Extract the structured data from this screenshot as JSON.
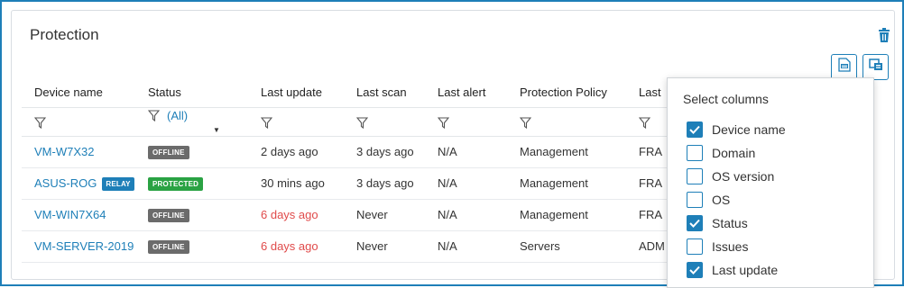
{
  "panel": {
    "title": "Protection"
  },
  "columns": [
    "Device name",
    "Status",
    "Last update",
    "Last scan",
    "Last alert",
    "Protection Policy",
    "Last"
  ],
  "status_filter": {
    "value": "(All)"
  },
  "rows": [
    {
      "device": "VM-W7X32",
      "relay": "",
      "status": "OFFLINE",
      "last_update": "2 days ago",
      "last_scan": "3 days ago",
      "last_alert": "N/A",
      "policy": "Management",
      "last": "FRA"
    },
    {
      "device": "ASUS-ROG",
      "relay": "RELAY",
      "status": "PROTECTED",
      "last_update": "30 mins ago",
      "last_scan": "3 days ago",
      "last_alert": "N/A",
      "policy": "Management",
      "last": "FRA"
    },
    {
      "device": "VM-WIN7X64",
      "relay": "",
      "status": "OFFLINE",
      "last_update": "6 days ago",
      "last_scan": "Never",
      "last_alert": "N/A",
      "policy": "Management",
      "last": "FRA"
    },
    {
      "device": "VM-SERVER-2019",
      "relay": "",
      "status": "OFFLINE",
      "last_update": "6 days ago",
      "last_scan": "Never",
      "last_alert": "N/A",
      "policy": "Servers",
      "last": "ADM"
    }
  ],
  "column_selector": {
    "title": "Select columns",
    "options": [
      {
        "label": "Device name",
        "checked": true
      },
      {
        "label": "Domain",
        "checked": false
      },
      {
        "label": "OS version",
        "checked": false
      },
      {
        "label": "OS",
        "checked": false
      },
      {
        "label": "Status",
        "checked": true
      },
      {
        "label": "Issues",
        "checked": false
      },
      {
        "label": "Last update",
        "checked": true
      }
    ]
  },
  "colors": {
    "accent": "#1e7fb8",
    "offline": "#6b6b6b",
    "protected": "#2aa243",
    "warning_text": "#e04b4b"
  },
  "icons": {
    "delete": "trash-icon",
    "export": "export-icon",
    "columns": "column-select-icon",
    "filter": "funnel-icon"
  }
}
